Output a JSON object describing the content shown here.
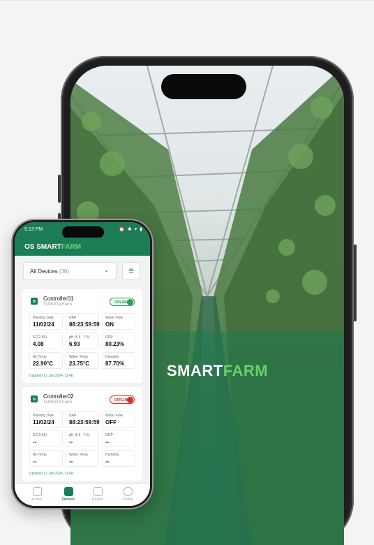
{
  "front_app": {
    "status_time": "5:13 PM",
    "status_icons": "⏰ ✱ ▾ ▮",
    "app_title_main": "OS SMART",
    "app_title_accent": "FARM",
    "device_filter": {
      "selected": "All Devices",
      "count": "(30)"
    },
    "cards": [
      {
        "name": "Controller01",
        "farm": "TUNGGA Farm",
        "status": "ONLINE",
        "metrics": [
          {
            "label": "Planting Date",
            "value": "11/02/24"
          },
          {
            "label": "DAP",
            "value": "88:23:59:59"
          },
          {
            "label": "Water Flow",
            "value": "ON"
          },
          {
            "label": "EC(2.56)",
            "value": "4.08"
          },
          {
            "label": "pH (5.6 - 7.5)",
            "value": "6.93"
          },
          {
            "label": "ORP",
            "value": "80.23%"
          },
          {
            "label": "Air Temp",
            "value": "22.90°C"
          },
          {
            "label": "Water Temp",
            "value": "23.75°C"
          },
          {
            "label": "Humidity",
            "value": "87.70%"
          }
        ],
        "updated": "Updated 12 Jan 2024, 11:48"
      },
      {
        "name": "Controller02",
        "farm": "TUNGGA Farm",
        "status": "OFFLINE",
        "metrics": [
          {
            "label": "Planting Date",
            "value": "11/02/24"
          },
          {
            "label": "DAP",
            "value": "88:23:59:59"
          },
          {
            "label": "Water Flow",
            "value": "OFF"
          },
          {
            "label": "EC(2.56)",
            "value": "--"
          },
          {
            "label": "pH (5.6 - 7.5)",
            "value": "--"
          },
          {
            "label": "ORP",
            "value": "--"
          },
          {
            "label": "Air Temp",
            "value": "--"
          },
          {
            "label": "Water Temp",
            "value": "--"
          },
          {
            "label": "Humidity",
            "value": "--"
          }
        ],
        "updated": "Updated 12 Jan 2024, 11:48"
      }
    ],
    "nav": [
      {
        "label": "Home",
        "icon": "home-icon",
        "active": false
      },
      {
        "label": "Device",
        "icon": "device-icon",
        "active": true
      },
      {
        "label": "Report",
        "icon": "report-icon",
        "active": false
      },
      {
        "label": "Profile",
        "icon": "profile-icon",
        "active": false
      }
    ]
  },
  "back_screen": {
    "logo_main": "SMART",
    "logo_accent": "FARM"
  },
  "colors": {
    "brand_green": "#1c7d55",
    "accent_green": "#6bd372",
    "online": "#2e9c5b",
    "offline": "#d93030"
  }
}
